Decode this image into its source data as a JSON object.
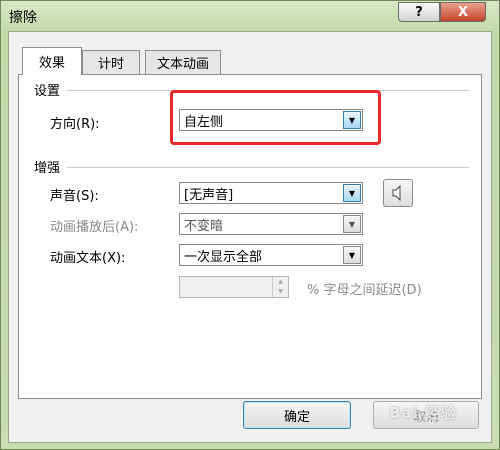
{
  "window": {
    "title": "擦除",
    "help_label": "?",
    "close_label": "X"
  },
  "tabs": [
    {
      "label": "效果",
      "active": true
    },
    {
      "label": "计时",
      "active": false
    },
    {
      "label": "文本动画",
      "active": false
    }
  ],
  "settings": {
    "heading": "设置",
    "direction": {
      "label": "方向(R):",
      "value": "自左侧"
    }
  },
  "enhance": {
    "heading": "增强",
    "sound": {
      "label": "声音(S):",
      "value": "[无声音]"
    },
    "after_animation": {
      "label": "动画播放后(A):",
      "value": "不变暗",
      "disabled": true
    },
    "animate_text": {
      "label": "动画文本(X):",
      "value": "一次显示全部"
    },
    "delay": {
      "value": "",
      "suffix": "% 字母之间延迟(D)",
      "disabled": true
    }
  },
  "buttons": {
    "ok": "确定",
    "cancel": "取消"
  },
  "watermark": "Bai 经验",
  "colors": {
    "highlight": "#e8282a",
    "focus_blue": "#3c7fb1"
  },
  "icons": {
    "sound": "speaker-icon",
    "dropdown": "chevron-down-icon"
  }
}
